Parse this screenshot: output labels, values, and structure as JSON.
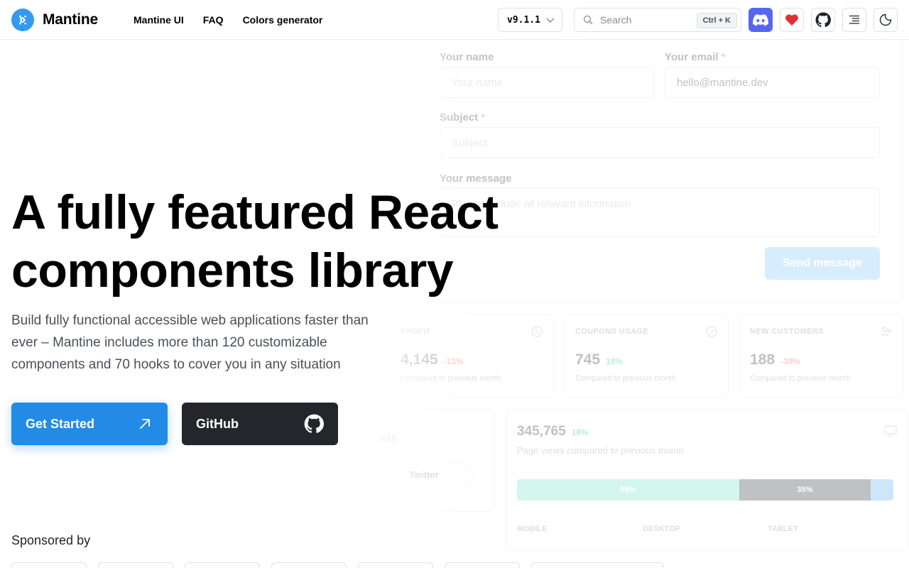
{
  "header": {
    "logo_text": "Mantine",
    "nav": [
      "Mantine UI",
      "FAQ",
      "Colors generator"
    ],
    "version": "v9.1.1",
    "search": {
      "label": "Search",
      "shortcut": "Ctrl + K"
    },
    "icons": [
      "discord-icon",
      "heart-icon",
      "github-icon",
      "table-of-contents-icon",
      "moon-icon"
    ]
  },
  "hero": {
    "title_line1": "A fully featured React",
    "title_line2": "components library",
    "description": "Build fully functional accessible web applications faster than ever – Mantine includes more than 120 customizable components and 70 hooks to cover you in any situation",
    "primary_button": "Get Started",
    "secondary_button": "GitHub"
  },
  "sponsors": {
    "label": "Sponsored by",
    "count": 7
  },
  "demo": {
    "form": {
      "name_label": "Your name",
      "name_placeholder": "Your name",
      "email_label": "Your email",
      "email_value": "hello@mantine.dev",
      "subject_label": "Subject",
      "subject_placeholder": "Subject",
      "message_label": "Your message",
      "message_placeholder": "Please include all relevant information",
      "submit": "Send message",
      "required_mark": "*"
    },
    "stats": [
      {
        "title": "PROFIT",
        "value": "4,145",
        "diff": "-13%",
        "trend": "down",
        "sub": "Compared to previous month"
      },
      {
        "title": "COUPONS USAGE",
        "value": "745",
        "diff": "18%",
        "trend": "up",
        "sub": "Compared to previous month"
      },
      {
        "title": "NEW CUSTOMERS",
        "value": "188",
        "diff": "-30%",
        "trend": "down",
        "sub": "Compared to previous month"
      }
    ],
    "page_views": {
      "value": "345,765",
      "diff": "18%",
      "sub": "Page views compared to previous month",
      "segments": [
        {
          "label": "MOBILE",
          "percent": 59,
          "display": "59%",
          "color": "#63e6be"
        },
        {
          "label": "DESKTOP",
          "percent": 35,
          "display": "35%",
          "color": "#212529"
        },
        {
          "label": "TABLET",
          "percent": 6,
          "display": "",
          "color": "#4dabf7"
        }
      ]
    },
    "social": {
      "text": "with",
      "button": "Twitter"
    }
  },
  "colors": {
    "primary": "#228be6",
    "dark": "#25262b",
    "discord": "#5865f2",
    "heart": "#e03131"
  }
}
